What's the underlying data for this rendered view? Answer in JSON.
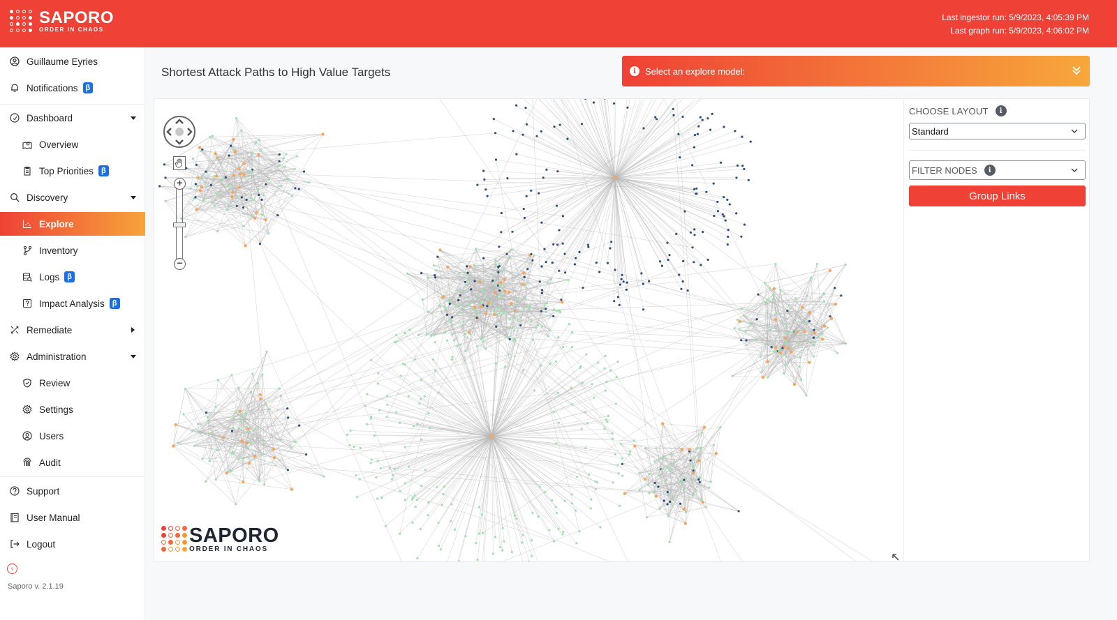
{
  "brand": {
    "name": "SAPORO",
    "tagline": "ORDER IN CHAOS"
  },
  "header": {
    "last_ingestor_run": "Last ingestor run: 5/9/2023, 4:05:39 PM",
    "last_graph_run": "Last graph run: 5/9/2023, 4:06:02 PM"
  },
  "sidebar": {
    "user": {
      "label": "Guillaume Eyries",
      "icon": "user-circle-icon"
    },
    "notifications": {
      "label": "Notifications",
      "badge": "β",
      "icon": "bell-icon"
    },
    "items": [
      {
        "label": "Dashboard",
        "icon": "dashboard-gauge-icon",
        "level": 1,
        "caret": "down"
      },
      {
        "label": "Overview",
        "icon": "map-pin-icon",
        "level": 2
      },
      {
        "label": "Top Priorities",
        "icon": "clipboard-list-icon",
        "level": 2,
        "badge": "β"
      },
      {
        "label": "Discovery",
        "icon": "search-icon",
        "level": 1,
        "caret": "down"
      },
      {
        "label": "Explore",
        "icon": "scatter-chart-icon",
        "level": 2,
        "active": true
      },
      {
        "label": "Inventory",
        "icon": "git-branch-icon",
        "level": 2
      },
      {
        "label": "Logs",
        "icon": "log-search-icon",
        "level": 2,
        "badge": "β"
      },
      {
        "label": "Impact Analysis",
        "icon": "question-square-icon",
        "level": 2,
        "badge": "β"
      },
      {
        "label": "Remediate",
        "icon": "tools-icon",
        "level": 1,
        "caret": "right"
      },
      {
        "label": "Administration",
        "icon": "gear-icon",
        "level": 1,
        "caret": "down"
      },
      {
        "label": "Review",
        "icon": "shield-check-icon",
        "level": 2
      },
      {
        "label": "Settings",
        "icon": "gear-icon",
        "level": 2
      },
      {
        "label": "Users",
        "icon": "user-circle-icon",
        "level": 2
      },
      {
        "label": "Audit",
        "icon": "fingerprint-icon",
        "level": 2
      }
    ],
    "footer_items": [
      {
        "label": "Support",
        "icon": "help-circle-icon"
      },
      {
        "label": "User Manual",
        "icon": "book-icon"
      },
      {
        "label": "Logout",
        "icon": "logout-icon"
      }
    ],
    "collapse_icon": "chevron-left-circle-icon",
    "version": "Saporo v. 2.1.19"
  },
  "main": {
    "title": "Shortest Attack Paths to High Value Targets",
    "banner": {
      "text": "Select an explore model:",
      "icon": "info-icon",
      "expand_icon": "double-chevron-down-icon"
    },
    "right_pane": {
      "choose_layout_label": "CHOOSE LAYOUT",
      "layout_value": "Standard",
      "filter_nodes_placeholder": "FILTER NODES",
      "group_links_label": "Group Links"
    },
    "graph": {
      "node_colors": {
        "hub": "#f7a65a",
        "user": "#2c4f7c",
        "asset": "#9be3ad"
      },
      "edge_color": "#b8b8b8",
      "clusters": [
        {
          "name": "top-left-mesh",
          "type": "mesh",
          "center": [
            0.11,
            0.17
          ],
          "spread": [
            0.15,
            0.16
          ],
          "nodes": 110,
          "mix": [
            0.2,
            0.25,
            0.55
          ]
        },
        {
          "name": "left-lower-mesh",
          "type": "mesh",
          "center": [
            0.12,
            0.72
          ],
          "spread": [
            0.13,
            0.2
          ],
          "nodes": 80,
          "mix": [
            0.2,
            0.15,
            0.65
          ]
        },
        {
          "name": "center-mesh",
          "type": "mesh",
          "center": [
            0.44,
            0.43
          ],
          "spread": [
            0.14,
            0.17
          ],
          "nodes": 150,
          "mix": [
            0.18,
            0.25,
            0.57
          ]
        },
        {
          "name": "right-mesh",
          "type": "mesh",
          "center": [
            0.85,
            0.5
          ],
          "spread": [
            0.12,
            0.17
          ],
          "nodes": 100,
          "mix": [
            0.25,
            0.15,
            0.6
          ]
        },
        {
          "name": "bottom-right-mesh",
          "type": "mesh",
          "center": [
            0.7,
            0.82
          ],
          "spread": [
            0.1,
            0.15
          ],
          "nodes": 80,
          "mix": [
            0.2,
            0.2,
            0.6
          ]
        },
        {
          "name": "top-star",
          "type": "star",
          "center": [
            0.615,
            0.17
          ],
          "radius": 0.19,
          "nodes": 190,
          "leaf": "user"
        },
        {
          "name": "bottom-star",
          "type": "star",
          "center": [
            0.45,
            0.73
          ],
          "radius": 0.2,
          "nodes": 230,
          "leaf": "asset"
        }
      ]
    },
    "controls": {
      "pan_icon": "pan-arrows-icon",
      "hand_icon": "hand-icon",
      "zoom_in": "+",
      "zoom_out": "−",
      "zoom_level": 0.55,
      "resize_icon": "arrow-up-left-icon"
    }
  }
}
